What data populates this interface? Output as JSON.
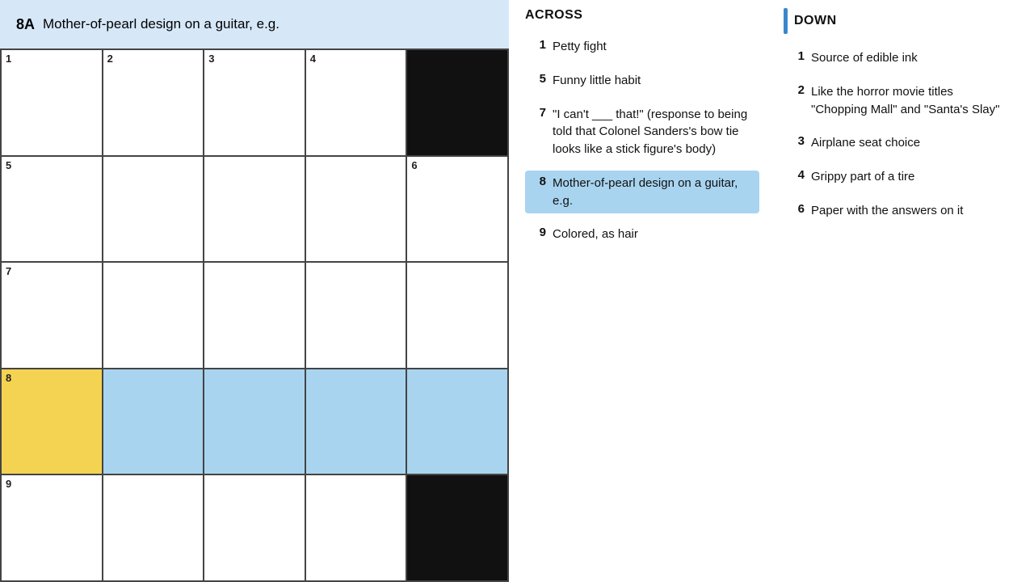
{
  "header": {
    "clue_number": "8A",
    "clue_text": "Mother-of-pearl design on a guitar, e.g."
  },
  "grid": {
    "rows": 5,
    "cols": 5,
    "cells": [
      {
        "row": 0,
        "col": 0,
        "type": "white",
        "number": "1"
      },
      {
        "row": 0,
        "col": 1,
        "type": "white",
        "number": "2"
      },
      {
        "row": 0,
        "col": 2,
        "type": "white",
        "number": "3"
      },
      {
        "row": 0,
        "col": 3,
        "type": "white",
        "number": "4"
      },
      {
        "row": 0,
        "col": 4,
        "type": "black",
        "number": ""
      },
      {
        "row": 1,
        "col": 0,
        "type": "white",
        "number": "5"
      },
      {
        "row": 1,
        "col": 1,
        "type": "white",
        "number": ""
      },
      {
        "row": 1,
        "col": 2,
        "type": "white",
        "number": ""
      },
      {
        "row": 1,
        "col": 3,
        "type": "white",
        "number": ""
      },
      {
        "row": 1,
        "col": 4,
        "type": "white",
        "number": "6"
      },
      {
        "row": 2,
        "col": 0,
        "type": "white",
        "number": "7"
      },
      {
        "row": 2,
        "col": 1,
        "type": "white",
        "number": ""
      },
      {
        "row": 2,
        "col": 2,
        "type": "white",
        "number": ""
      },
      {
        "row": 2,
        "col": 3,
        "type": "white",
        "number": ""
      },
      {
        "row": 2,
        "col": 4,
        "type": "white",
        "number": ""
      },
      {
        "row": 3,
        "col": 0,
        "type": "yellow",
        "number": "8"
      },
      {
        "row": 3,
        "col": 1,
        "type": "blue",
        "number": ""
      },
      {
        "row": 3,
        "col": 2,
        "type": "blue",
        "number": ""
      },
      {
        "row": 3,
        "col": 3,
        "type": "blue",
        "number": ""
      },
      {
        "row": 3,
        "col": 4,
        "type": "blue",
        "number": ""
      },
      {
        "row": 4,
        "col": 0,
        "type": "white",
        "number": "9"
      },
      {
        "row": 4,
        "col": 1,
        "type": "white",
        "number": ""
      },
      {
        "row": 4,
        "col": 2,
        "type": "white",
        "number": ""
      },
      {
        "row": 4,
        "col": 3,
        "type": "white",
        "number": ""
      },
      {
        "row": 4,
        "col": 4,
        "type": "black",
        "number": ""
      }
    ]
  },
  "across": {
    "title": "ACROSS",
    "clues": [
      {
        "number": "1",
        "text": "Petty fight",
        "highlighted": false
      },
      {
        "number": "5",
        "text": "Funny little habit",
        "highlighted": false
      },
      {
        "number": "7",
        "text": "\"I can't ___ that!\" (response to being told that Colonel Sanders's bow tie looks like a stick figure's body)",
        "highlighted": false
      },
      {
        "number": "8",
        "text": "Mother-of-pearl design on a guitar, e.g.",
        "highlighted": true
      },
      {
        "number": "9",
        "text": "Colored, as hair",
        "highlighted": false
      }
    ]
  },
  "down": {
    "title": "DOWN",
    "clues": [
      {
        "number": "1",
        "text": "Source of edible ink",
        "highlighted": false
      },
      {
        "number": "2",
        "text": "Like the horror movie titles \"Chopping Mall\" and \"Santa's Slay\"",
        "highlighted": false
      },
      {
        "number": "3",
        "text": "Airplane seat choice",
        "highlighted": false
      },
      {
        "number": "4",
        "text": "Grippy part of a tire",
        "highlighted": false
      },
      {
        "number": "6",
        "text": "Paper with the answers on it",
        "highlighted": false
      }
    ]
  }
}
